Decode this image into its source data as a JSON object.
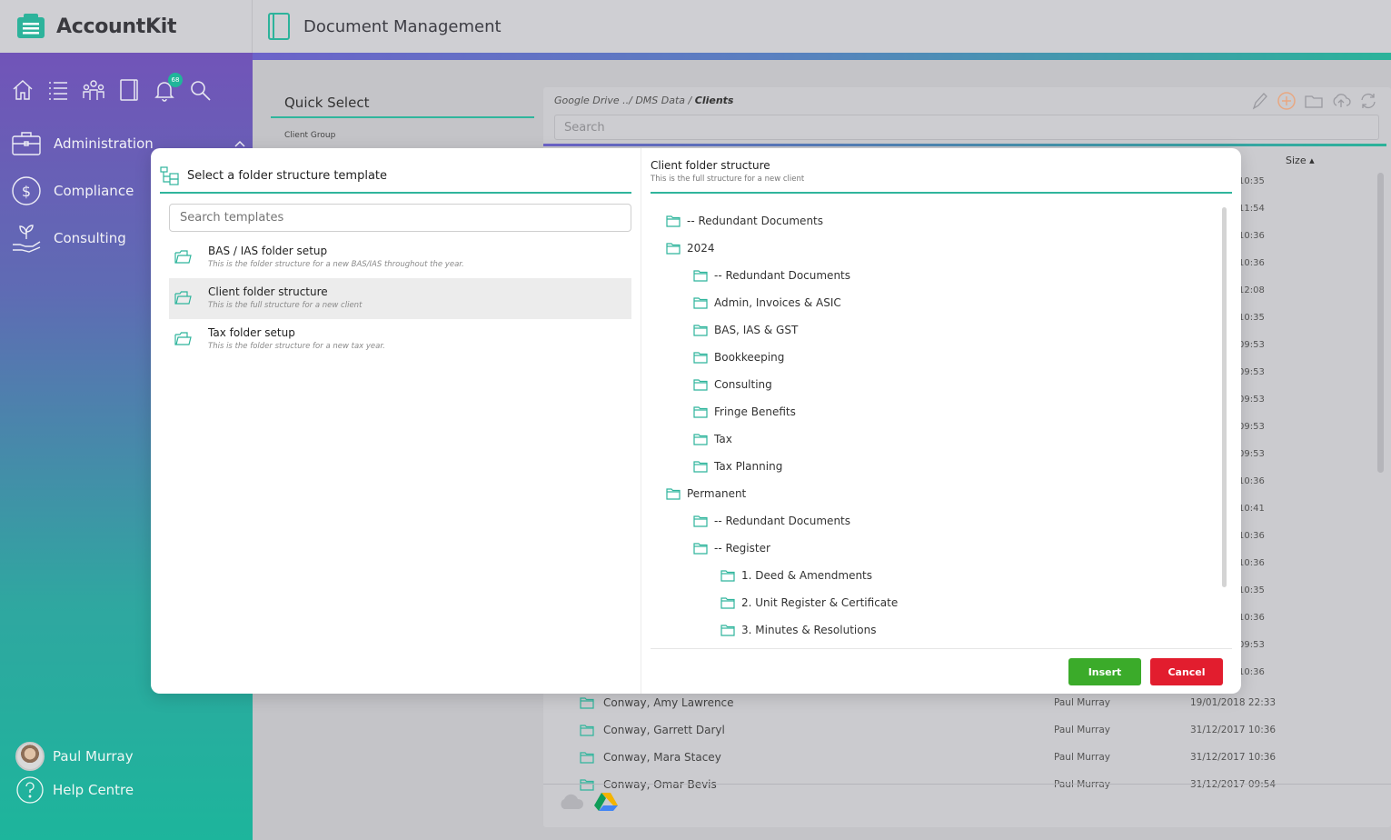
{
  "app": {
    "name": "AccountKit"
  },
  "header": {
    "title": "Document Management"
  },
  "sidebar": {
    "tools": [
      {
        "icon": "home-icon"
      },
      {
        "icon": "list-icon"
      },
      {
        "icon": "people-icon"
      },
      {
        "icon": "book-icon"
      },
      {
        "icon": "notifications-icon",
        "badge": "68"
      },
      {
        "icon": "search-icon"
      }
    ],
    "items": [
      {
        "label": "Administration",
        "icon": "briefcase-icon"
      },
      {
        "label": "Compliance",
        "icon": "dollar-icon"
      },
      {
        "label": "Consulting",
        "icon": "plant-hand-icon"
      }
    ],
    "user": {
      "name": "Paul Murray"
    },
    "help": {
      "label": "Help Centre"
    }
  },
  "quick_select": {
    "title": "Quick Select",
    "label": "Client Group"
  },
  "dms": {
    "breadcrumb": {
      "root": "Google Drive",
      "sep1": "../",
      "mid": "DMS Data",
      "sep2": "/",
      "current": "Clients"
    },
    "search_placeholder": "Search",
    "size_header": "Size",
    "times": [
      "10:35",
      "11:54",
      "10:36",
      "10:36",
      "12:08",
      "10:35",
      "09:53",
      "09:53",
      "09:53",
      "09:53",
      "09:53",
      "10:36",
      "10:41",
      "10:36",
      "10:36",
      "10:35",
      "10:36",
      "09:53",
      "10:36"
    ],
    "rows": [
      {
        "name": "Conway, Amy Lawrence",
        "owner": "Paul Murray",
        "date": "19/01/2018 22:33"
      },
      {
        "name": "Conway, Garrett Daryl",
        "owner": "Paul Murray",
        "date": "31/12/2017 10:36"
      },
      {
        "name": "Conway, Mara Stacey",
        "owner": "Paul Murray",
        "date": "31/12/2017 10:36"
      },
      {
        "name": "Conway, Omar Bevis",
        "owner": "Paul Murray",
        "date": "31/12/2017 09:54"
      }
    ]
  },
  "modal": {
    "left_title": "Select a folder structure template",
    "search_placeholder": "Search templates",
    "templates": [
      {
        "name": "BAS / IAS folder setup",
        "desc": "This is the folder structure for a new BAS/IAS throughout the year."
      },
      {
        "name": "Client folder structure",
        "desc": "This is the full structure for a new client"
      },
      {
        "name": "Tax folder setup",
        "desc": "This is the folder structure for a new tax year."
      }
    ],
    "right_title": "Client folder structure",
    "right_subtitle": "This is the full structure for a new client",
    "tree": [
      {
        "label": "-- Redundant Documents",
        "level": 0
      },
      {
        "label": "2024",
        "level": 0
      },
      {
        "label": "-- Redundant Documents",
        "level": 1
      },
      {
        "label": "Admin, Invoices & ASIC",
        "level": 1
      },
      {
        "label": "BAS, IAS & GST",
        "level": 1
      },
      {
        "label": "Bookkeeping",
        "level": 1
      },
      {
        "label": "Consulting",
        "level": 1
      },
      {
        "label": "Fringe Benefits",
        "level": 1
      },
      {
        "label": "Tax",
        "level": 1
      },
      {
        "label": "Tax Planning",
        "level": 1
      },
      {
        "label": "Permanent",
        "level": 0
      },
      {
        "label": "-- Redundant Documents",
        "level": 1
      },
      {
        "label": "-- Register",
        "level": 1
      },
      {
        "label": "1. Deed & Amendments",
        "level": 2
      },
      {
        "label": "2. Unit Register & Certificate",
        "level": 2
      },
      {
        "label": "3. Minutes & Resolutions",
        "level": 2
      }
    ],
    "insert_label": "Insert",
    "cancel_label": "Cancel"
  },
  "colors": {
    "accent": "#2fb59c",
    "insert": "#3bab2a",
    "cancel": "#e21d2e",
    "sidebar_top": "#7154b8",
    "sidebar_bottom": "#1db59c"
  }
}
